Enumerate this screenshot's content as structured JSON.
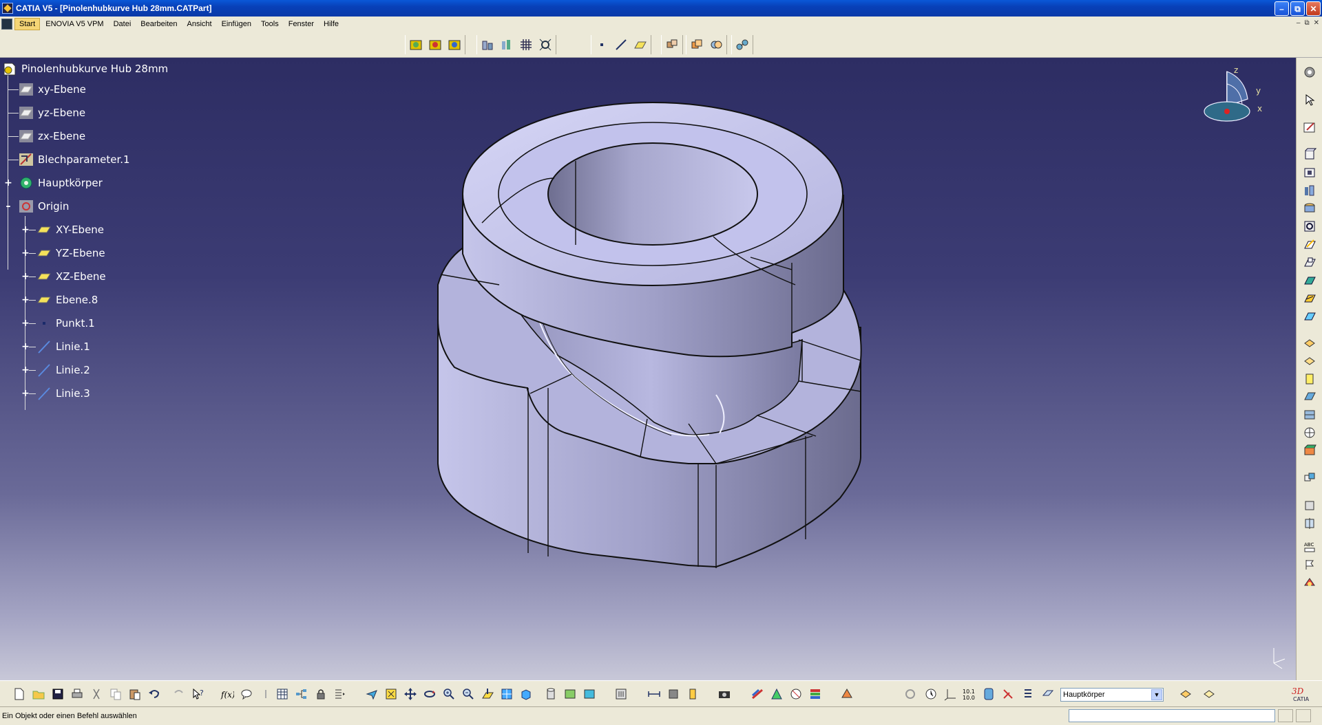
{
  "window": {
    "title": "CATIA V5 - [Pinolenhubkurve Hub 28mm.CATPart]",
    "buttons": [
      "minimize",
      "restore",
      "close"
    ]
  },
  "menubar": {
    "items": [
      "Start",
      "ENOVIA V5 VPM",
      "Datei",
      "Bearbeiten",
      "Ansicht",
      "Einfügen",
      "Tools",
      "Fenster",
      "Hilfe"
    ],
    "active": "Start"
  },
  "tree": {
    "root": "Pinolenhubkurve Hub 28mm",
    "items": [
      {
        "label": "xy-Ebene",
        "icon": "plane-icon"
      },
      {
        "label": "yz-Ebene",
        "icon": "plane-icon"
      },
      {
        "label": "zx-Ebene",
        "icon": "plane-icon"
      },
      {
        "label": "Blechparameter.1",
        "icon": "sheetmetal-parameters-icon"
      },
      {
        "label": "Hauptkörper",
        "icon": "partbody-gear-icon"
      },
      {
        "label": "Origin",
        "icon": "origin-icon"
      }
    ],
    "origin_children": [
      {
        "label": "XY-Ebene",
        "icon": "plane-icon"
      },
      {
        "label": "YZ-Ebene",
        "icon": "plane-icon"
      },
      {
        "label": "XZ-Ebene",
        "icon": "plane-icon"
      },
      {
        "label": "Ebene.8",
        "icon": "plane-icon"
      },
      {
        "label": "Punkt.1",
        "icon": "point-icon"
      },
      {
        "label": "Linie.1",
        "icon": "line-icon"
      },
      {
        "label": "Linie.2",
        "icon": "line-icon"
      },
      {
        "label": "Linie.3",
        "icon": "line-icon"
      }
    ]
  },
  "compass": {
    "x": "x",
    "y": "y",
    "z": "z"
  },
  "bottom": {
    "current_body": "Hauptkörper"
  },
  "status": {
    "text": "Ein Objekt oder einen Befehl auswählen"
  },
  "colors": {
    "titlebar": "#0a4fd0",
    "viewport_top": "#2d2d63",
    "viewport_bottom": "#c8c8d8",
    "part_face": "#b9b9e4",
    "toolbar": "#ece9d8"
  }
}
